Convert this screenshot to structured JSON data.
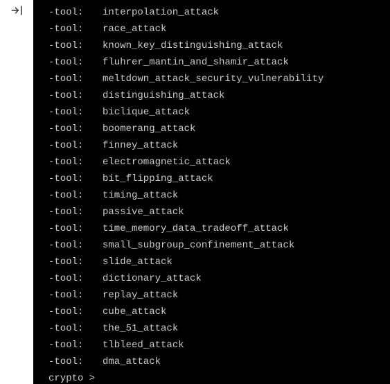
{
  "sidebar": {
    "exit_icon_name": "exit-icon"
  },
  "terminal": {
    "flag_label": "-tool:",
    "lines": [
      {
        "value": "interpolation_attack"
      },
      {
        "value": "race_attack"
      },
      {
        "value": "known_key_distinguishing_attack"
      },
      {
        "value": "fluhrer_mantin_and_shamir_attack"
      },
      {
        "value": "meltdown_attack_security_vulnerability"
      },
      {
        "value": "distinguishing_attack"
      },
      {
        "value": "biclique_attack"
      },
      {
        "value": "boomerang_attack"
      },
      {
        "value": "finney_attack"
      },
      {
        "value": "electromagnetic_attack"
      },
      {
        "value": "bit_flipping_attack"
      },
      {
        "value": "timing_attack"
      },
      {
        "value": "passive_attack"
      },
      {
        "value": "time_memory_data_tradeoff_attack"
      },
      {
        "value": "small_subgroup_confinement_attack"
      },
      {
        "value": "slide_attack"
      },
      {
        "value": "dictionary_attack"
      },
      {
        "value": "replay_attack"
      },
      {
        "value": "cube_attack"
      },
      {
        "value": "the_51_attack"
      },
      {
        "value": "tlbleed_attack"
      },
      {
        "value": "dma_attack"
      }
    ],
    "prompt": "crypto > "
  }
}
